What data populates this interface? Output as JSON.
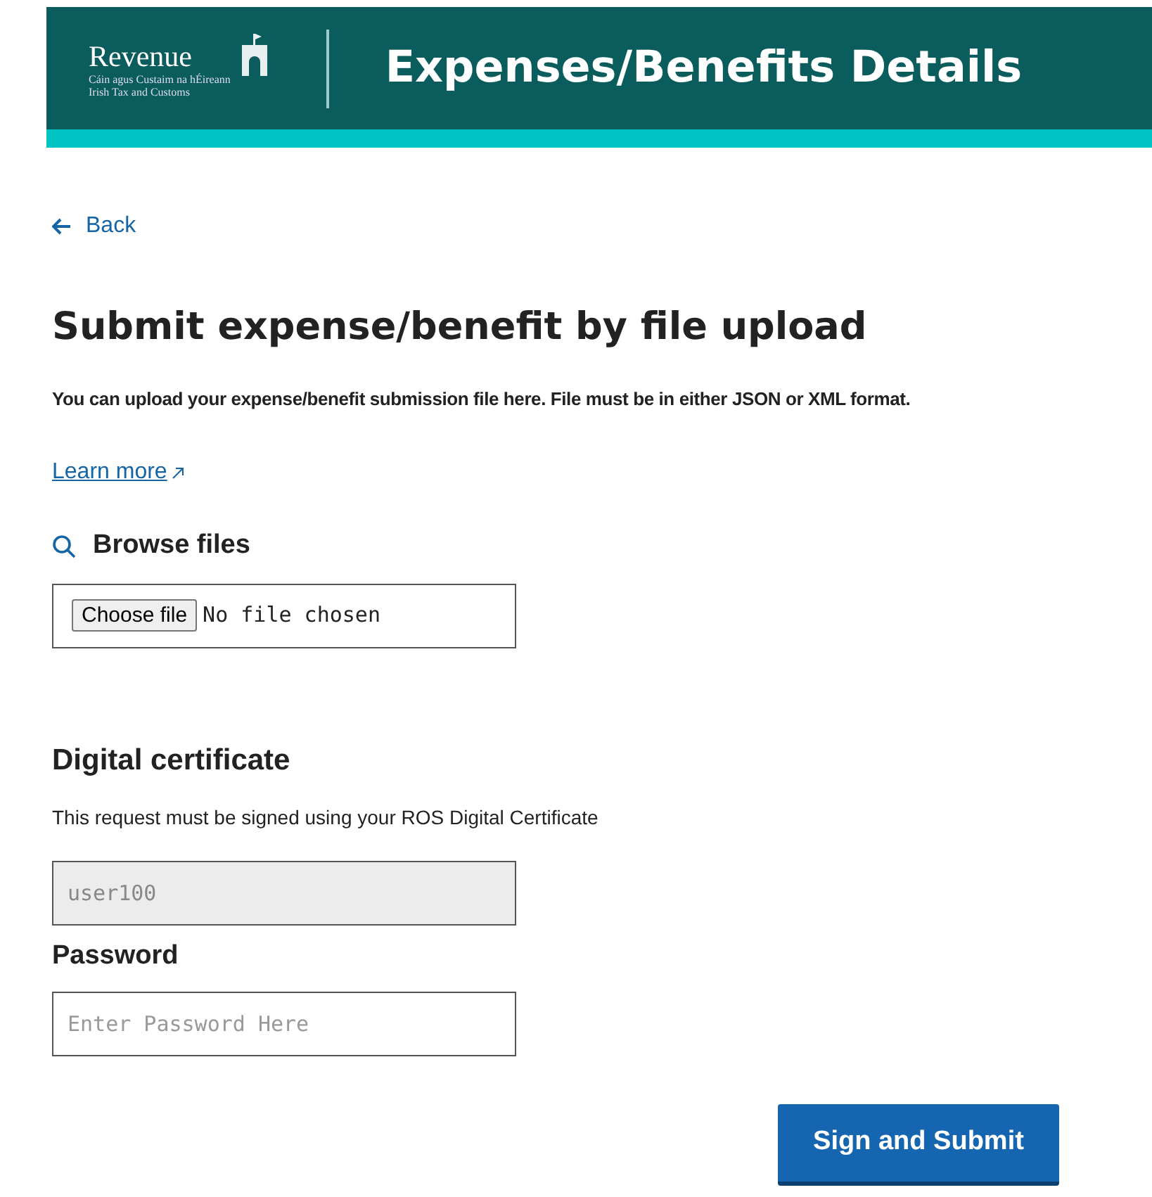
{
  "header": {
    "logo_name": "Revenue",
    "logo_tagline": [
      "Cáin agus Custaim na hÉireann",
      "Irish Tax and Customs"
    ],
    "title": "Expenses/Benefits Details"
  },
  "back_link": {
    "label": "Back"
  },
  "heading": "Submit expense/benefit by file upload",
  "intro": "You can upload your expense/benefit submission file here. File must be in either JSON or XML format.",
  "learn_more": {
    "label": "Learn more",
    "external": true
  },
  "browse": {
    "label": "Browse files",
    "button": "Choose file",
    "status": "No file chosen"
  },
  "certificate": {
    "heading": "Digital certificate",
    "description": "This request must be signed using your ROS Digital Certificate",
    "user": {
      "value": "user100",
      "disabled": true
    }
  },
  "password": {
    "label": "Password",
    "placeholder": "Enter Password Here"
  },
  "submit": {
    "label": "Sign and Submit"
  }
}
